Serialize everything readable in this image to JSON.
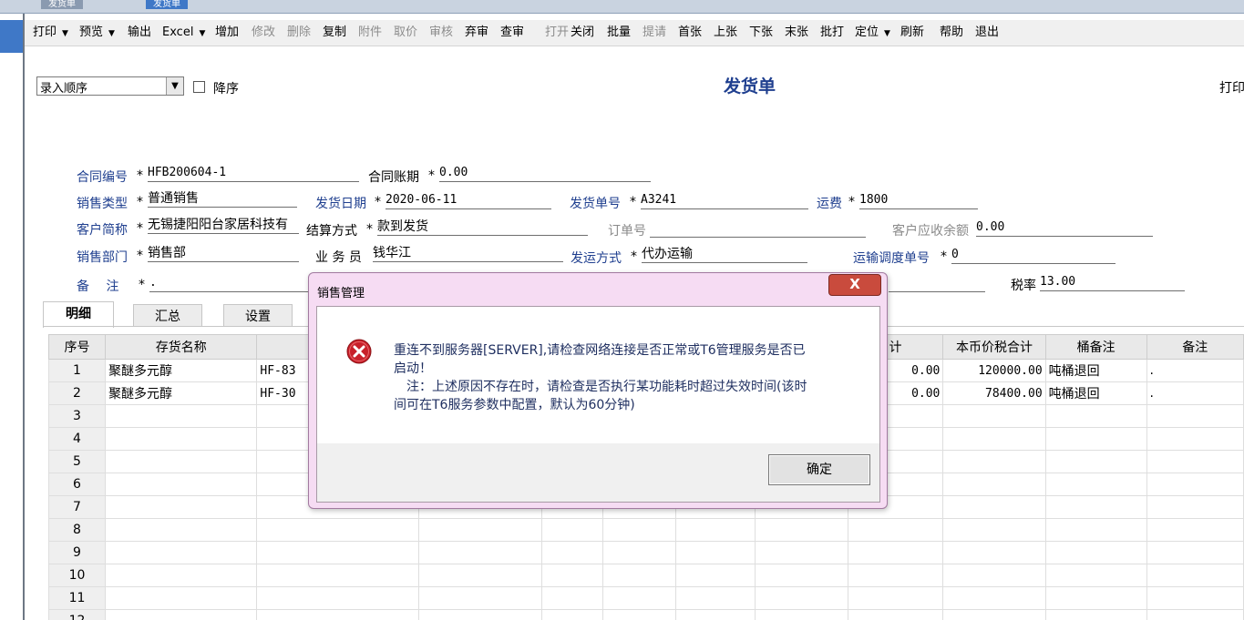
{
  "top_tabs": [
    "发货单",
    "发货单"
  ],
  "toolbar": [
    {
      "label": "打印",
      "dropdown": true,
      "enabled": true
    },
    {
      "label": "预览",
      "dropdown": true,
      "enabled": true
    },
    {
      "label": "输出",
      "dropdown": false,
      "enabled": true
    },
    {
      "label": "Excel",
      "dropdown": true,
      "enabled": true
    },
    {
      "label": "增加",
      "dropdown": false,
      "enabled": true
    },
    {
      "label": "修改",
      "dropdown": false,
      "enabled": false
    },
    {
      "label": "删除",
      "dropdown": false,
      "enabled": false
    },
    {
      "label": "复制",
      "dropdown": false,
      "enabled": true
    },
    {
      "label": "附件",
      "dropdown": false,
      "enabled": false
    },
    {
      "label": "取价",
      "dropdown": false,
      "enabled": false
    },
    {
      "label": "审核",
      "dropdown": false,
      "enabled": false
    },
    {
      "label": "弃审",
      "dropdown": false,
      "enabled": true
    },
    {
      "label": "查审",
      "dropdown": false,
      "enabled": true
    },
    {
      "label": "打开",
      "dropdown": false,
      "enabled": false
    },
    {
      "label": "关闭",
      "dropdown": false,
      "enabled": true
    },
    {
      "label": "批量",
      "dropdown": false,
      "enabled": true
    },
    {
      "label": "提请",
      "dropdown": false,
      "enabled": false
    },
    {
      "label": "首张",
      "dropdown": false,
      "enabled": true
    },
    {
      "label": "上张",
      "dropdown": false,
      "enabled": true
    },
    {
      "label": "下张",
      "dropdown": false,
      "enabled": true
    },
    {
      "label": "末张",
      "dropdown": false,
      "enabled": true
    },
    {
      "label": "批打",
      "dropdown": false,
      "enabled": true
    },
    {
      "label": "定位",
      "dropdown": true,
      "enabled": true
    },
    {
      "label": "刷新",
      "dropdown": false,
      "enabled": true
    },
    {
      "label": "帮助",
      "dropdown": false,
      "enabled": true
    },
    {
      "label": "退出",
      "dropdown": false,
      "enabled": true
    }
  ],
  "sort": {
    "value": "录入顺序",
    "desc_label": "降序",
    "desc_checked": false
  },
  "doc_title": "发货单",
  "print_label": "打印",
  "fields": {
    "contract_no": {
      "label": "合同编号",
      "value": "HFB200604-1"
    },
    "contract_term": {
      "label": "合同账期",
      "value": "0.00"
    },
    "sales_type": {
      "label": "销售类型",
      "value": "普通销售"
    },
    "ship_date": {
      "label": "发货日期",
      "value": "2020-06-11"
    },
    "ship_no": {
      "label": "发货单号",
      "value": "A3241"
    },
    "freight": {
      "label": "运费",
      "value": "1800"
    },
    "customer": {
      "label": "客户简称",
      "value": "无锡捷阳阳台家居科技有"
    },
    "settle": {
      "label": "结算方式",
      "value": "款到发货"
    },
    "order_no": {
      "label": "订单号",
      "value": ""
    },
    "receivable": {
      "label": "客户应收余额",
      "value": "0.00"
    },
    "dept": {
      "label": "销售部门",
      "value": "销售部"
    },
    "salesman": {
      "label": "业 务 员",
      "value": "钱华江"
    },
    "ship_method": {
      "label": "发运方式",
      "value": "代办运输"
    },
    "dispatch_no": {
      "label": "运输调度单号",
      "value": "0"
    },
    "remark": {
      "label": "备　 注",
      "value": "."
    },
    "tax_rate": {
      "label": "税率",
      "value": "13.00"
    }
  },
  "tabs": [
    "明细",
    "汇总",
    "设置"
  ],
  "grid": {
    "columns": [
      "序号",
      "存货名称",
      "",
      "",
      "",
      "",
      "",
      "",
      "计",
      "本币价税合计",
      "桶备注",
      "备注"
    ],
    "rows": [
      {
        "idx": "1",
        "name": "聚醚多元醇",
        "code": "HF-83",
        "c8": "0.00",
        "total": "120000.00",
        "bucket": "吨桶退回",
        "remark": "."
      },
      {
        "idx": "2",
        "name": "聚醚多元醇",
        "code": "HF-30",
        "c8": "0.00",
        "total": "78400.00",
        "bucket": "吨桶退回",
        "remark": "."
      },
      {
        "idx": "3"
      },
      {
        "idx": "4"
      },
      {
        "idx": "5"
      },
      {
        "idx": "6"
      },
      {
        "idx": "7"
      },
      {
        "idx": "8"
      },
      {
        "idx": "9"
      },
      {
        "idx": "10"
      },
      {
        "idx": "11"
      },
      {
        "idx": "12"
      }
    ]
  },
  "dialog": {
    "title": "销售管理",
    "close": "X",
    "message_lines": [
      "重连不到服务器[SERVER],请检查网络连接是否正常或T6管理服务是否已",
      "启动！",
      "　注：上述原因不存在时，请检查是否执行某功能耗时超过失效时间(该时",
      "间可在T6服务参数中配置，默认为60分钟)"
    ],
    "ok_label": "确定",
    "icon": "error-icon"
  }
}
